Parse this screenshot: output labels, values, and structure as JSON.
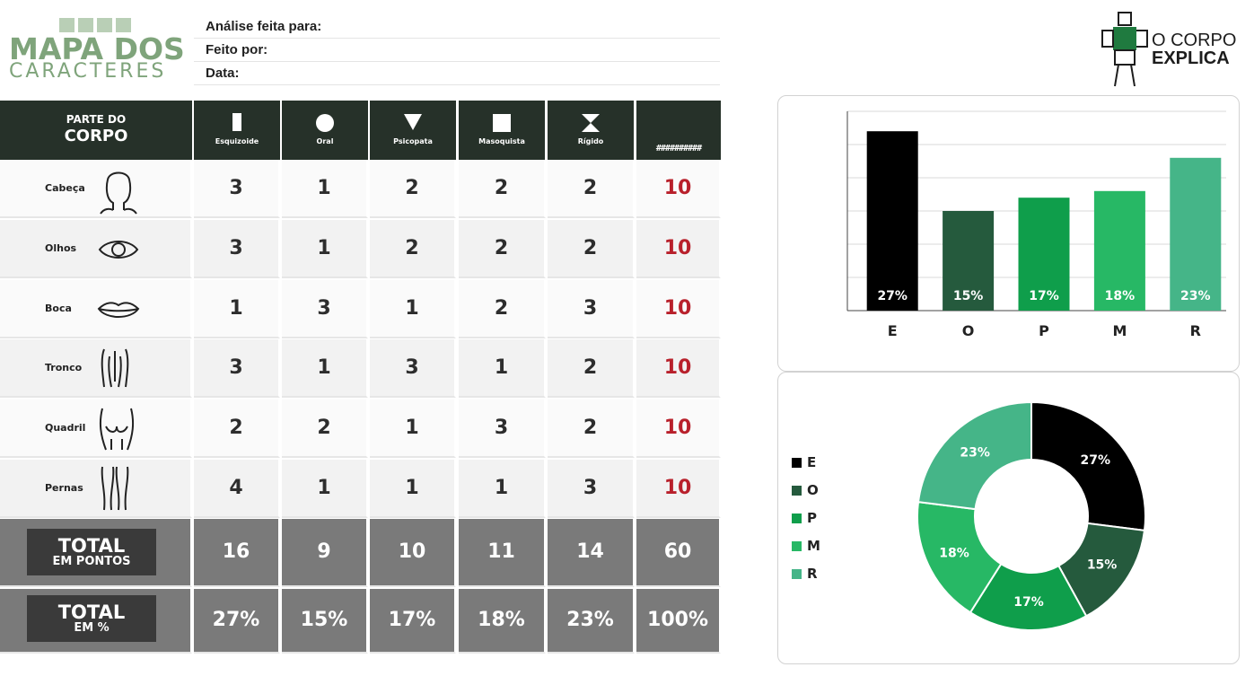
{
  "header": {
    "logo_title": "MAPA DOS",
    "logo_subtitle": "CARACTERES",
    "info_labels": [
      "Análise feita para:",
      "Feito por:",
      "Data:"
    ],
    "brand_line1": "O CORPO",
    "brand_line2": "EXPLICA"
  },
  "table": {
    "corner_line1": "PARTE DO",
    "corner_line2": "CORPO",
    "columns": [
      {
        "name": "Esquizoide",
        "icon": "rectangle-icon"
      },
      {
        "name": "Oral",
        "icon": "circle-icon"
      },
      {
        "name": "Psicopata",
        "icon": "triangle-down-icon"
      },
      {
        "name": "Masoquista",
        "icon": "square-icon"
      },
      {
        "name": "Rígido",
        "icon": "hourglass-icon"
      }
    ],
    "sum_header": "##########",
    "rows": [
      {
        "part": "Cabeça",
        "icon": "head-icon",
        "values": [
          "3",
          "1",
          "2",
          "2",
          "2"
        ],
        "total": "10"
      },
      {
        "part": "Olhos",
        "icon": "eye-icon",
        "values": [
          "3",
          "1",
          "2",
          "2",
          "2"
        ],
        "total": "10"
      },
      {
        "part": "Boca",
        "icon": "lips-icon",
        "values": [
          "1",
          "3",
          "1",
          "2",
          "3"
        ],
        "total": "10"
      },
      {
        "part": "Tronco",
        "icon": "torso-icon",
        "values": [
          "3",
          "1",
          "3",
          "1",
          "2"
        ],
        "total": "10"
      },
      {
        "part": "Quadril",
        "icon": "hips-icon",
        "values": [
          "2",
          "2",
          "1",
          "3",
          "2"
        ],
        "total": "10"
      },
      {
        "part": "Pernas",
        "icon": "legs-icon",
        "values": [
          "4",
          "1",
          "1",
          "1",
          "3"
        ],
        "total": "10"
      }
    ],
    "total_points": {
      "label1": "TOTAL",
      "label2": "EM PONTOS",
      "values": [
        "16",
        "9",
        "10",
        "11",
        "14"
      ],
      "total": "60"
    },
    "total_percent": {
      "label1": "TOTAL",
      "label2": "EM %",
      "values": [
        "27%",
        "15%",
        "17%",
        "18%",
        "23%"
      ],
      "total": "100%"
    }
  },
  "colors": {
    "E": "#000000",
    "O": "#255a3d",
    "P": "#0f9e4b",
    "M": "#27b865",
    "R": "#45b588",
    "header_dark": "#263129",
    "total_red": "#b8202b"
  },
  "chart_data": [
    {
      "type": "bar",
      "categories": [
        "E",
        "O",
        "P",
        "M",
        "R"
      ],
      "values": [
        27,
        15,
        17,
        18,
        23
      ],
      "labels": [
        "27%",
        "15%",
        "17%",
        "18%",
        "23%"
      ],
      "ylim": [
        0,
        30
      ],
      "grid": true
    },
    {
      "type": "pie",
      "donut": true,
      "categories": [
        "E",
        "O",
        "P",
        "M",
        "R"
      ],
      "values": [
        27,
        15,
        17,
        18,
        23
      ],
      "labels": [
        "27%",
        "15%",
        "17%",
        "18%",
        "23%"
      ],
      "legend": "left"
    }
  ]
}
